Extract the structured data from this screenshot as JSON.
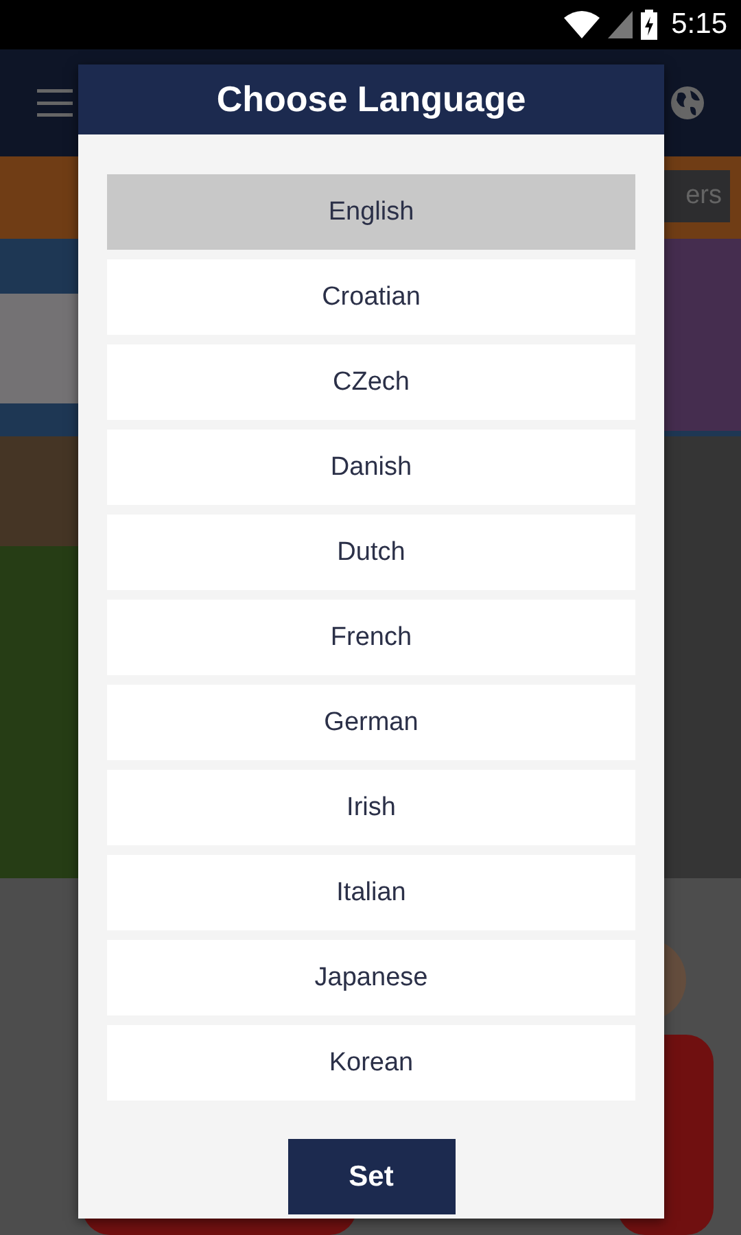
{
  "status_bar": {
    "time": "5:15"
  },
  "app_bar": {
    "chip": "ers"
  },
  "dialog": {
    "title": "Choose Language",
    "languages": [
      {
        "label": "English",
        "selected": true
      },
      {
        "label": "Croatian",
        "selected": false
      },
      {
        "label": "CZech",
        "selected": false
      },
      {
        "label": "Danish",
        "selected": false
      },
      {
        "label": "Dutch",
        "selected": false
      },
      {
        "label": "French",
        "selected": false
      },
      {
        "label": "German",
        "selected": false
      },
      {
        "label": "Irish",
        "selected": false
      },
      {
        "label": "Italian",
        "selected": false
      },
      {
        "label": "Japanese",
        "selected": false
      },
      {
        "label": "Korean",
        "selected": false
      }
    ],
    "button": "Set"
  }
}
